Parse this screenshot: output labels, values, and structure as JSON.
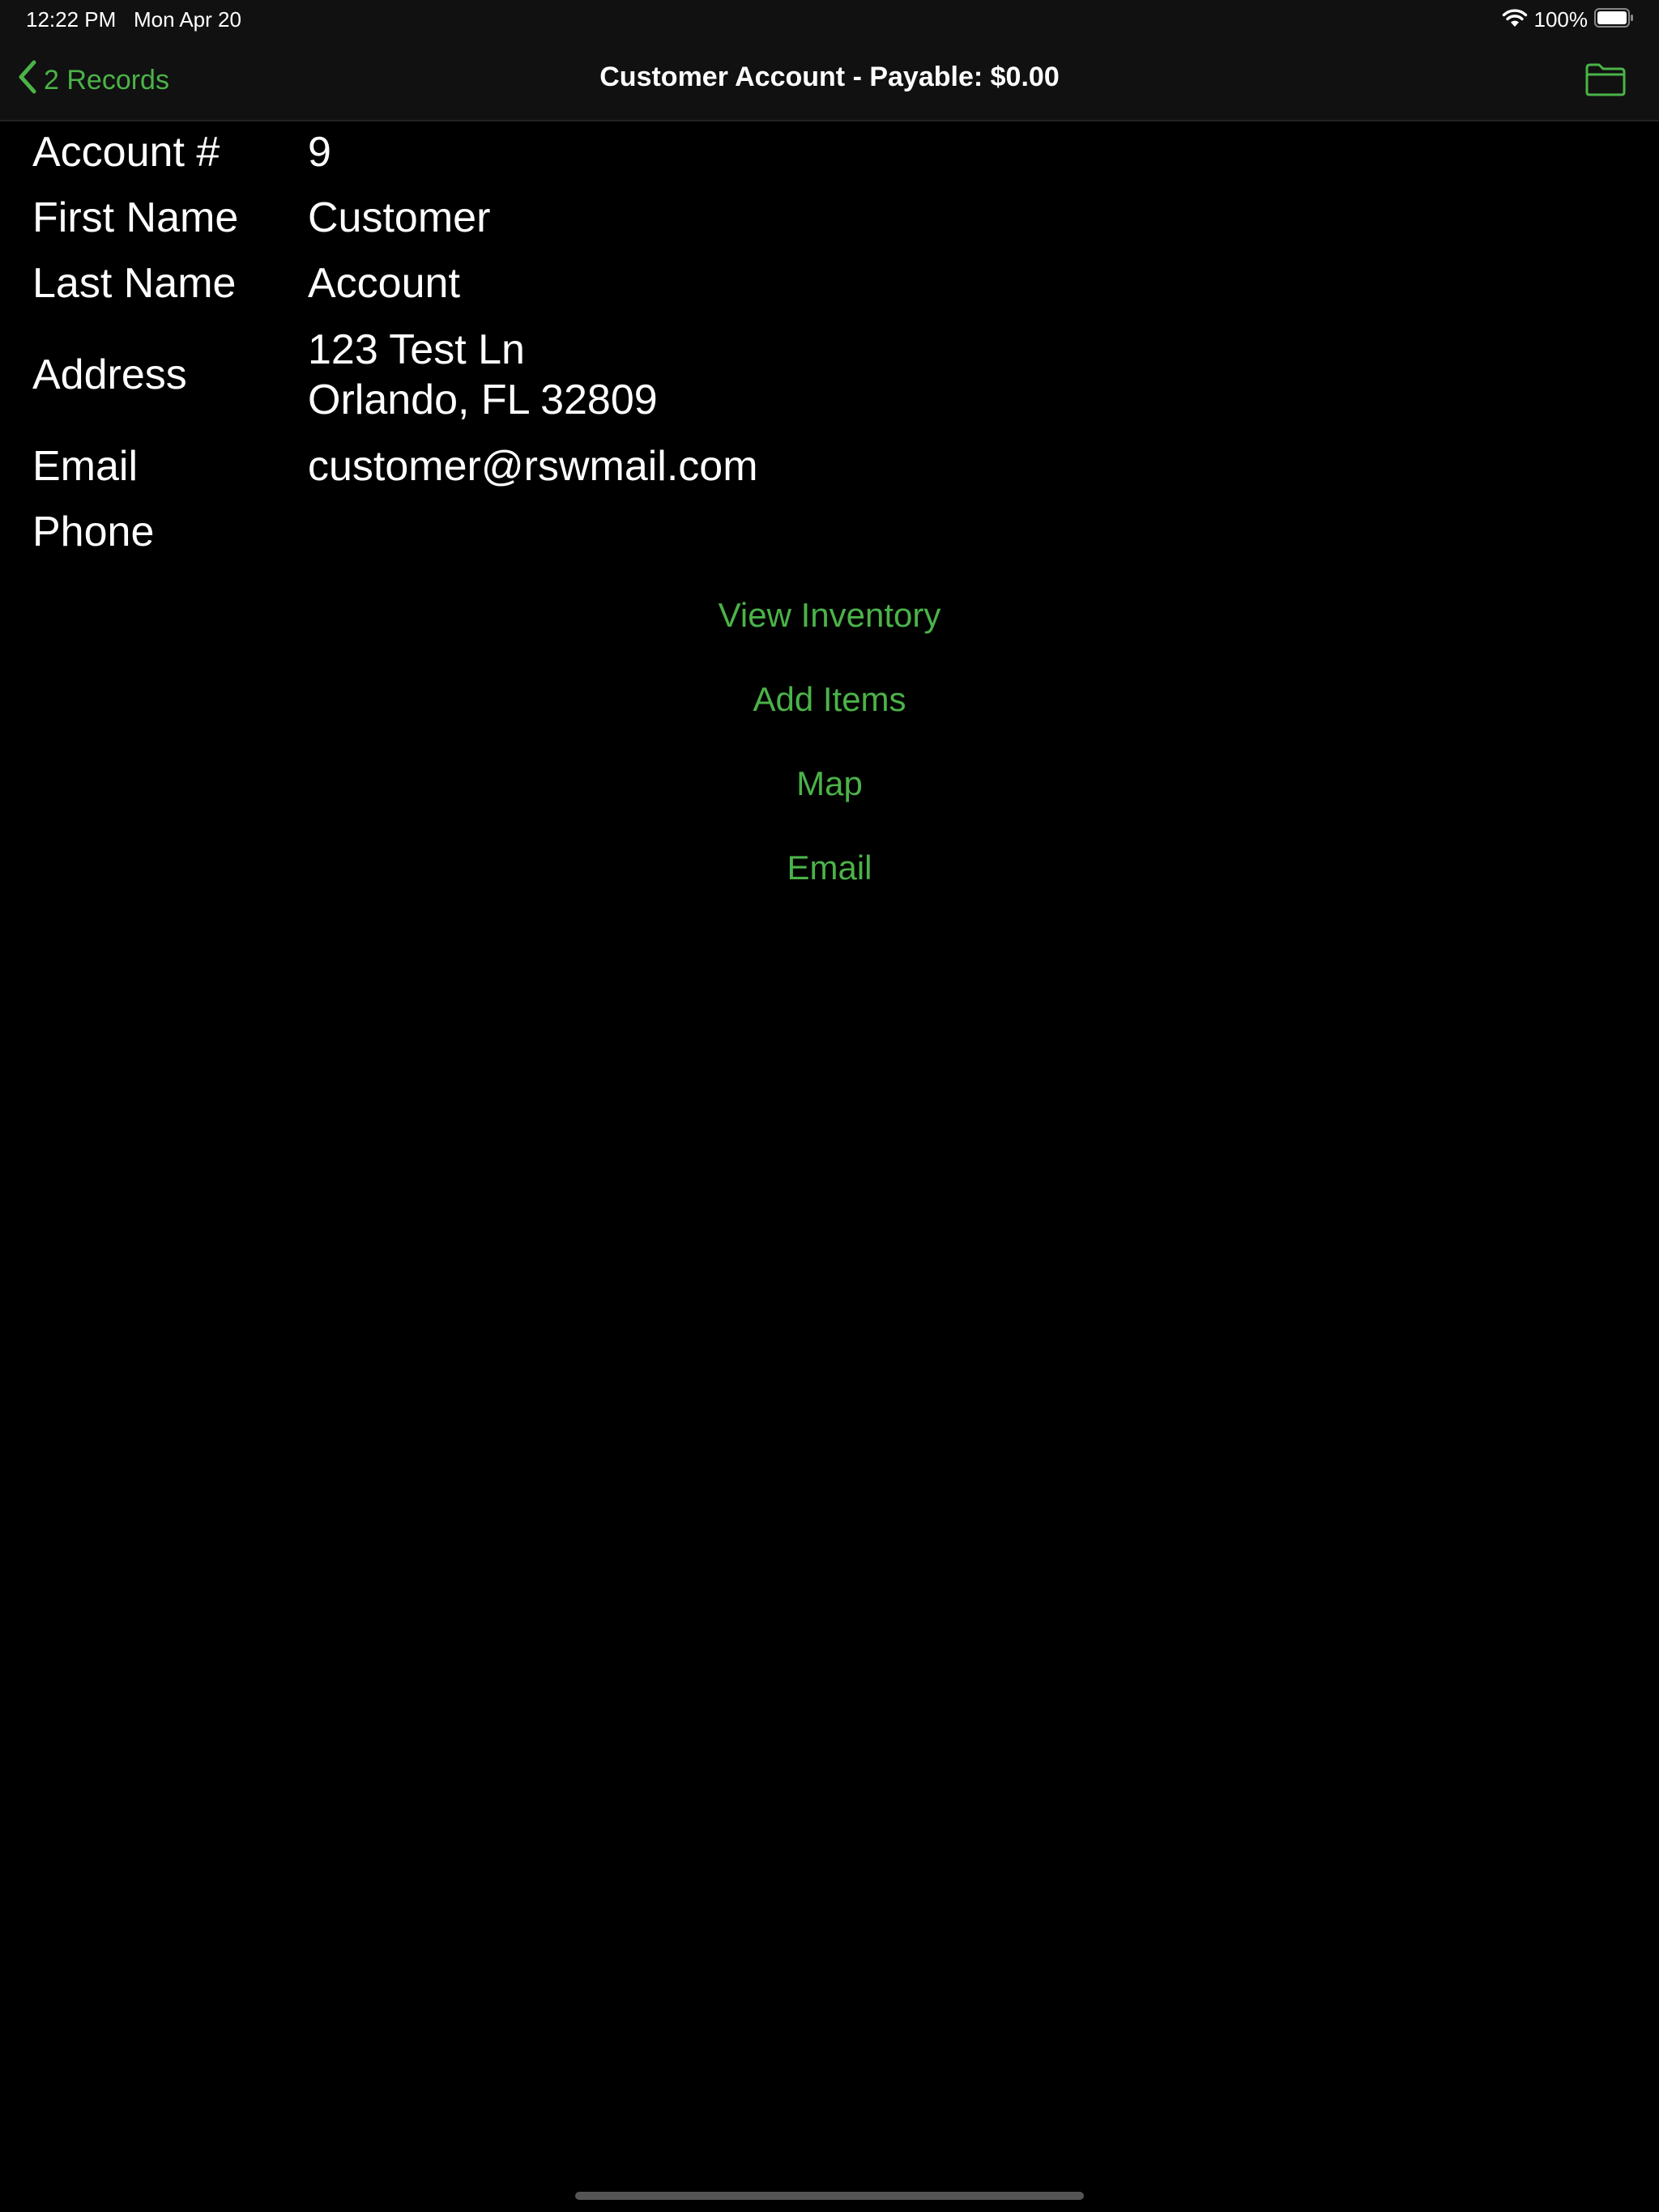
{
  "status_bar": {
    "time_date": "12:22 PM   Mon Apr 20",
    "battery_percent": "100%",
    "battery_level": 1.0
  },
  "nav": {
    "back_label": "2 Records",
    "title": "Customer Account - Payable: $0.00",
    "folder_icon": "folder-icon"
  },
  "fields": [
    {
      "label": "Account #",
      "value": "9"
    },
    {
      "label": "First Name",
      "value": "Customer"
    },
    {
      "label": "Last Name",
      "value": "Account"
    },
    {
      "label": "Address",
      "value_lines": [
        "123 Test Ln",
        "Orlando, FL 32809"
      ]
    },
    {
      "label": "Email",
      "value": "customer@rswmail.com"
    },
    {
      "label": "Phone",
      "value": ""
    }
  ],
  "actions": [
    "View Inventory",
    "Add Items",
    "Map",
    "Email"
  ],
  "colors": {
    "accent": "#4bb348",
    "background": "#000000",
    "bar": "#111111"
  }
}
